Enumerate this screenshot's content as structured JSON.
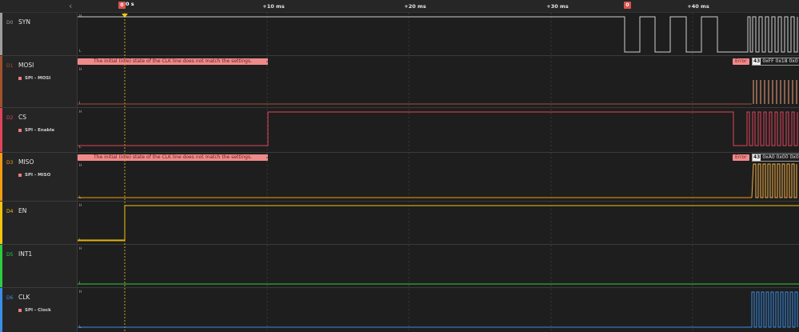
{
  "ruler": {
    "collapse_icon": "chevron-left",
    "ticks": [
      "+10 ms",
      "+20 ms",
      "+30 ms",
      "+40 ms"
    ],
    "zero_label": "0 s",
    "marker_a": "0",
    "marker_b": "0"
  },
  "level_high": "H",
  "level_low": "L",
  "channels": [
    {
      "chan": "D0",
      "name": "SYN",
      "color": "#9e9e9e",
      "analyzer": ""
    },
    {
      "chan": "D1",
      "name": "MOSI",
      "color": "#a0522d",
      "analyzer": "SPI - MOSI",
      "error_banner": "The initial (idle) state of the CLK line does not match the settings.",
      "error_tag": "Error",
      "hex_count": "43",
      "hex_values": "0xFF 0x18 0x0"
    },
    {
      "chan": "D2",
      "name": "CS",
      "color": "#e0445a",
      "analyzer": "SPI - Enable"
    },
    {
      "chan": "D3",
      "name": "MISO",
      "color": "#f39c12",
      "analyzer": "SPI - MISO",
      "error_banner": "The initial (idle) state of the CLK line does not match the settings.",
      "error_tag": "Error",
      "hex_count": "43",
      "hex_values": "0xA0 0x00 0x0"
    },
    {
      "chan": "D4",
      "name": "EN",
      "color": "#f1c40f",
      "analyzer": ""
    },
    {
      "chan": "D5",
      "name": "INT1",
      "color": "#2ecc40",
      "analyzer": ""
    },
    {
      "chan": "D6",
      "name": "CLK",
      "color": "#3a8ee6",
      "analyzer": "SPI - Clock"
    }
  ],
  "analyzer_color": "#f07b7b"
}
